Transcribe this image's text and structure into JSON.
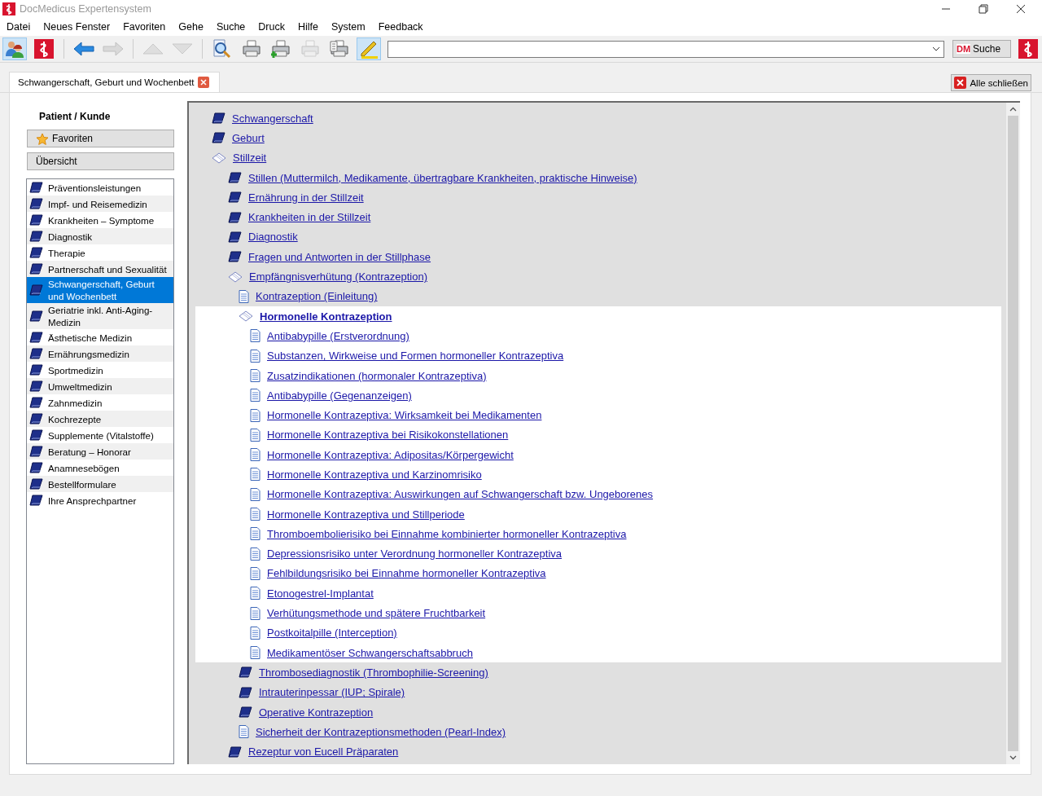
{
  "window": {
    "title": "DocMedicus Expertensystem"
  },
  "menu": [
    "Datei",
    "Neues Fenster",
    "Favoriten",
    "Gehe",
    "Suche",
    "Druck",
    "Hilfe",
    "System",
    "Feedback"
  ],
  "toolbar": [
    {
      "kind": "people",
      "pressed": true,
      "disabled": false
    },
    {
      "kind": "logo",
      "pressed": false,
      "disabled": false
    },
    {
      "kind": "sep"
    },
    {
      "kind": "back",
      "pressed": false,
      "disabled": false
    },
    {
      "kind": "forward",
      "pressed": false,
      "disabled": true
    },
    {
      "kind": "sep"
    },
    {
      "kind": "up",
      "pressed": false,
      "disabled": true
    },
    {
      "kind": "down",
      "pressed": false,
      "disabled": true
    },
    {
      "kind": "sep"
    },
    {
      "kind": "preview",
      "pressed": false,
      "disabled": false
    },
    {
      "kind": "print",
      "pressed": false,
      "disabled": false
    },
    {
      "kind": "print-add",
      "pressed": false,
      "disabled": false
    },
    {
      "kind": "print",
      "pressed": false,
      "disabled": true
    },
    {
      "kind": "print-list",
      "pressed": false,
      "disabled": false
    },
    {
      "kind": "pencil",
      "pressed": true,
      "disabled": false
    }
  ],
  "search_button": {
    "badge": "DM",
    "label": "Suche"
  },
  "tabs": [
    {
      "label": "Schwangerschaft, Geburt und Wochenbett",
      "selected": true
    }
  ],
  "close_all": "Alle schließen",
  "sidebar": {
    "heading": "Patient / Kunde",
    "favorites": "Favoriten",
    "overview": "Übersicht",
    "items": [
      {
        "label": "Präventionsleistungen",
        "selected": false
      },
      {
        "label": "Impf- und Reisemedizin",
        "selected": false
      },
      {
        "label": "Krankheiten – Symptome",
        "selected": false
      },
      {
        "label": "Diagnostik",
        "selected": false
      },
      {
        "label": "Therapie",
        "selected": false
      },
      {
        "label": "Partnerschaft und Sexualität",
        "selected": false
      },
      {
        "label": "Schwangerschaft, Geburt und Wochenbett",
        "selected": true
      },
      {
        "label": "Geriatrie inkl. Anti-Aging-Medizin",
        "selected": false
      },
      {
        "label": "Ästhetische Medizin",
        "selected": false
      },
      {
        "label": "Ernährungsmedizin",
        "selected": false
      },
      {
        "label": "Sportmedizin",
        "selected": false
      },
      {
        "label": "Umweltmedizin",
        "selected": false
      },
      {
        "label": "Zahnmedizin",
        "selected": false
      },
      {
        "label": "Kochrezepte",
        "selected": false
      },
      {
        "label": "Supplemente (Vitalstoffe)",
        "selected": false
      },
      {
        "label": "Beratung – Honorar",
        "selected": false
      },
      {
        "label": "Anamnesebögen",
        "selected": false
      },
      {
        "label": "Bestellformulare",
        "selected": false
      },
      {
        "label": "Ihre Ansprechpartner",
        "selected": false
      }
    ]
  },
  "tree": [
    {
      "label": "Schwangerschaft",
      "kind": "book",
      "selected": false
    },
    {
      "label": "Geburt",
      "kind": "book",
      "selected": false
    },
    {
      "label": "Stillzeit",
      "kind": "open",
      "selected": false,
      "children": [
        {
          "label": "Stillen (Muttermilch, Medikamente, übertragbare Krankheiten, praktische Hinweise)",
          "kind": "book",
          "selected": false
        },
        {
          "label": "Ernährung in der Stillzeit",
          "kind": "book",
          "selected": false
        },
        {
          "label": "Krankheiten in der Stillzeit",
          "kind": "book",
          "selected": false
        },
        {
          "label": "Diagnostik",
          "kind": "book",
          "selected": false
        },
        {
          "label": "Fragen und Antworten in der Stillphase",
          "kind": "book",
          "selected": false
        },
        {
          "label": "Empfängnisverhütung (Kontrazeption)",
          "kind": "open",
          "selected": false,
          "children": [
            {
              "label": "Kontrazeption (Einleitung)",
              "kind": "page",
              "selected": false
            },
            {
              "label": "Hormonelle Kontrazeption",
              "kind": "open",
              "selected": true,
              "children": [
                {
                  "label": "Antibabypille (Erstverordnung)",
                  "kind": "page",
                  "selected": false
                },
                {
                  "label": "Substanzen, Wirkweise und Formen hormoneller Kontrazeptiva",
                  "kind": "page",
                  "selected": false
                },
                {
                  "label": "Zusatzindikationen (hormonaler Kontrazeptiva)",
                  "kind": "page",
                  "selected": false
                },
                {
                  "label": "Antibabypille (Gegenanzeigen)",
                  "kind": "page",
                  "selected": false
                },
                {
                  "label": "Hormonelle Kontrazeptiva: Wirksamkeit bei Medikamenten",
                  "kind": "page",
                  "selected": false
                },
                {
                  "label": "Hormonelle Kontrazeptiva bei Risikokonstellationen",
                  "kind": "page",
                  "selected": false
                },
                {
                  "label": "Hormonelle Kontrazeptiva: Adipositas/Körpergewicht",
                  "kind": "page",
                  "selected": false
                },
                {
                  "label": "Hormonelle Kontrazeptiva und Karzinomrisiko",
                  "kind": "page",
                  "selected": false
                },
                {
                  "label": "Hormonelle Kontrazeptiva: Auswirkungen auf Schwangerschaft bzw. Ungeborenes",
                  "kind": "page",
                  "selected": false
                },
                {
                  "label": "Hormonelle Kontrazeptiva und Stillperiode",
                  "kind": "page",
                  "selected": false
                },
                {
                  "label": "Thromboembolierisiko bei Einnahme kombinierter hormoneller Kontrazeptiva",
                  "kind": "page",
                  "selected": false
                },
                {
                  "label": "Depressionsrisiko unter Verordnung hormoneller Kontrazeptiva",
                  "kind": "page",
                  "selected": false
                },
                {
                  "label": "Fehlbildungsrisiko bei Einnahme hormoneller Kontrazeptiva",
                  "kind": "page",
                  "selected": false
                },
                {
                  "label": "Etonogestrel-Implantat",
                  "kind": "page",
                  "selected": false
                },
                {
                  "label": "Verhütungsmethode und spätere Fruchtbarkeit",
                  "kind": "page",
                  "selected": false
                },
                {
                  "label": "Postkoitalpille (Interception)",
                  "kind": "page",
                  "selected": false
                },
                {
                  "label": "Medikamentöser Schwangerschaftsabbruch",
                  "kind": "page",
                  "selected": false
                }
              ]
            },
            {
              "label": "Thrombosediagnostik (Thrombophilie-Screening)",
              "kind": "book",
              "selected": false
            },
            {
              "label": "Intrauterinpessar (IUP; Spirale)",
              "kind": "book",
              "selected": false
            },
            {
              "label": "Operative Kontrazeption",
              "kind": "book",
              "selected": false
            },
            {
              "label": "Sicherheit der Kontrazeptionsmethoden (Pearl-Index)",
              "kind": "page",
              "selected": false
            }
          ]
        },
        {
          "label": "Rezeptur von Eucell Präparaten",
          "kind": "book",
          "selected": false
        }
      ]
    }
  ]
}
